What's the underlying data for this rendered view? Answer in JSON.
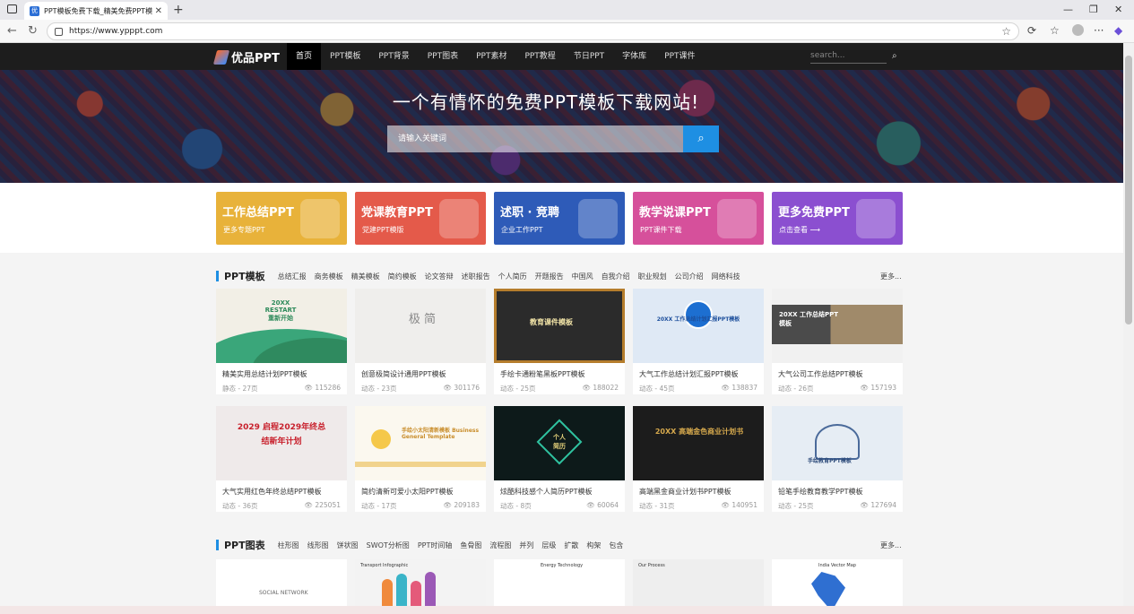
{
  "browser": {
    "tab_title": "PPT模板免费下载_精美免费PPT模",
    "tab_favicon": "优",
    "url": "https://www.ypppt.com"
  },
  "site": {
    "logo": "优品PPT",
    "menu": [
      "首页",
      "PPT模板",
      "PPT背景",
      "PPT图表",
      "PPT素材",
      "PPT教程",
      "节日PPT",
      "字体库",
      "PPT课件"
    ],
    "search_placeholder": "search..."
  },
  "banner": {
    "title": "一个有情怀的免费PPT模板下载网站!",
    "search_placeholder": "请输入关键词"
  },
  "promos": [
    {
      "title": "工作总结PPT",
      "sub": "更多专题PPT",
      "color": "#e8b23a"
    },
    {
      "title": "党课教育PPT",
      "sub": "党建PPT模版",
      "color": "#e45a4a"
    },
    {
      "title": "述职 · 竞聘",
      "sub": "企业工作PPT",
      "color": "#2e5bb8"
    },
    {
      "title": "教学说课PPT",
      "sub": "PPT课件下载",
      "color": "#d6509b"
    },
    {
      "title": "更多免费PPT",
      "sub": "点击查看 ⟶",
      "color": "#8b4fd0"
    }
  ],
  "sections": {
    "templates": {
      "title": "PPT模板",
      "tags": [
        "总结汇报",
        "商务模板",
        "精美模板",
        "简约模板",
        "论文答辩",
        "述职报告",
        "个人简历",
        "开题报告",
        "中国风",
        "自我介绍",
        "职业规划",
        "公司介绍",
        "网络科技"
      ],
      "more": "更多..."
    },
    "charts": {
      "title": "PPT图表",
      "tags": [
        "柱形图",
        "线形图",
        "饼状图",
        "SWOT分析图",
        "PPT时间轴",
        "鱼骨图",
        "流程图",
        "并列",
        "层级",
        "扩散",
        "构架",
        "包含"
      ],
      "more": "更多..."
    }
  },
  "cards": [
    {
      "name": "精美实用总结计划PPT模板",
      "meta": "静态 - 27页",
      "views": "115286",
      "thumb_text": "20XX RESTART 重新开始"
    },
    {
      "name": "创意极简设计通用PPT模板",
      "meta": "动态 - 23页",
      "views": "301176",
      "thumb_text": "极 简"
    },
    {
      "name": "手绘卡通粉笔黑板PPT模板",
      "meta": "动态 - 25页",
      "views": "188022",
      "thumb_text": "教育课件模板"
    },
    {
      "name": "大气工作总结计划汇报PPT模板",
      "meta": "动态 - 45页",
      "views": "138837",
      "thumb_text": "20XX 工作总结计划汇报PPT模板"
    },
    {
      "name": "大气公司工作总结PPT模板",
      "meta": "动态 - 26页",
      "views": "157193",
      "thumb_text": "20XX 工作总结PPT模板"
    },
    {
      "name": "大气实用红色年终总结PPT模板",
      "meta": "动态 - 36页",
      "views": "225051",
      "thumb_text": "2029 启程2029年终总结新年计划"
    },
    {
      "name": "简约清新可爱小太阳PPT模板",
      "meta": "动态 - 17页",
      "views": "209183",
      "thumb_text": "手绘小太阳清新模板 Business General Template"
    },
    {
      "name": "炫酷科技感个人简历PPT模板",
      "meta": "动态 - 8页",
      "views": "60064",
      "thumb_text": "个人 简历"
    },
    {
      "name": "高端黑金商业计划书PPT模板",
      "meta": "动态 - 31页",
      "views": "140951",
      "thumb_text": "20XX 高端金色商业计划书"
    },
    {
      "name": "铅笔手绘教育教学PPT模板",
      "meta": "动态 - 25页",
      "views": "127694",
      "thumb_text": "手绘教育PPT模板"
    }
  ],
  "chart_thumbs": [
    "SOCIAL NETWORK",
    "Transport Infographic",
    "Energy Technology",
    "Our Process",
    "India Vector Map"
  ]
}
